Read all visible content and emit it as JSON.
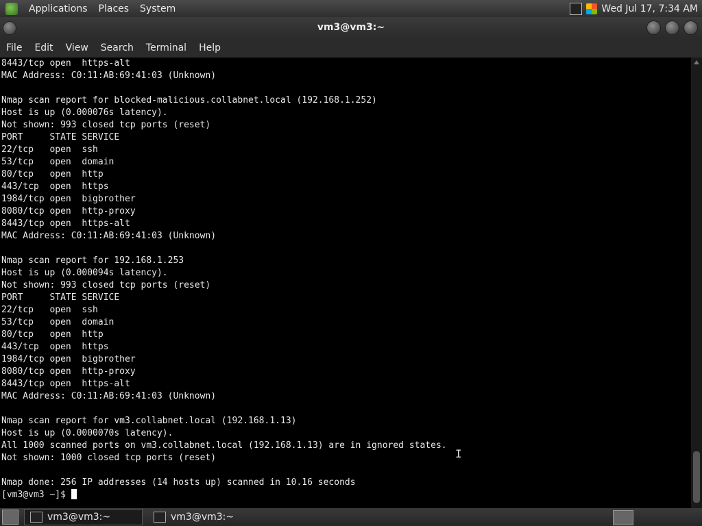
{
  "top_panel": {
    "menus": [
      "Applications",
      "Places",
      "System"
    ],
    "clock": "Wed Jul 17,  7:34 AM"
  },
  "window": {
    "title": "vm3@vm3:~"
  },
  "menubar": {
    "items": [
      "File",
      "Edit",
      "View",
      "Search",
      "Terminal",
      "Help"
    ]
  },
  "terminal": {
    "lines": [
      "8443/tcp open  https-alt",
      "MAC Address: C0:11:AB:69:41:03 (Unknown)",
      "",
      "Nmap scan report for blocked-malicious.collabnet.local (192.168.1.252)",
      "Host is up (0.000076s latency).",
      "Not shown: 993 closed tcp ports (reset)",
      "PORT     STATE SERVICE",
      "22/tcp   open  ssh",
      "53/tcp   open  domain",
      "80/tcp   open  http",
      "443/tcp  open  https",
      "1984/tcp open  bigbrother",
      "8080/tcp open  http-proxy",
      "8443/tcp open  https-alt",
      "MAC Address: C0:11:AB:69:41:03 (Unknown)",
      "",
      "Nmap scan report for 192.168.1.253",
      "Host is up (0.000094s latency).",
      "Not shown: 993 closed tcp ports (reset)",
      "PORT     STATE SERVICE",
      "22/tcp   open  ssh",
      "53/tcp   open  domain",
      "80/tcp   open  http",
      "443/tcp  open  https",
      "1984/tcp open  bigbrother",
      "8080/tcp open  http-proxy",
      "8443/tcp open  https-alt",
      "MAC Address: C0:11:AB:69:41:03 (Unknown)",
      "",
      "Nmap scan report for vm3.collabnet.local (192.168.1.13)",
      "Host is up (0.0000070s latency).",
      "All 1000 scanned ports on vm3.collabnet.local (192.168.1.13) are in ignored states.",
      "Not shown: 1000 closed tcp ports (reset)",
      "",
      "Nmap done: 256 IP addresses (14 hosts up) scanned in 10.16 seconds"
    ],
    "prompt": "[vm3@vm3 ~]$ "
  },
  "taskbar": {
    "tasks": [
      "vm3@vm3:~",
      "vm3@vm3:~"
    ]
  }
}
